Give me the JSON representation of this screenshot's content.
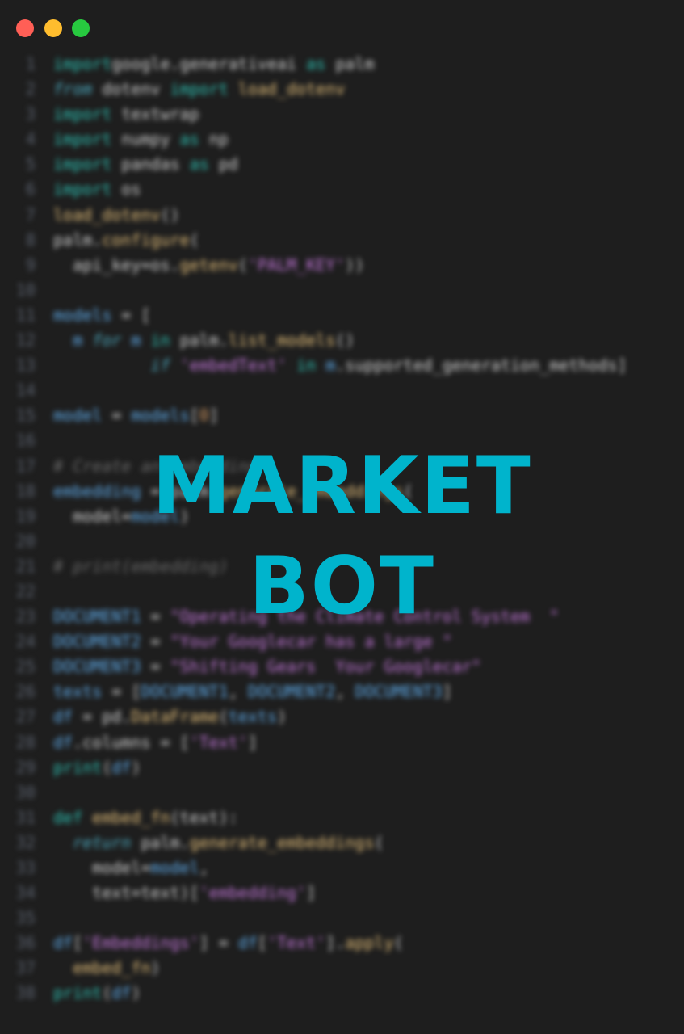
{
  "window": {
    "controls": [
      "close",
      "minimize",
      "zoom"
    ]
  },
  "code_lines": [
    {
      "n": "1",
      "parts": [
        [
          "kw",
          "import"
        ],
        [
          "",
          "google.generativeai "
        ],
        [
          "kw",
          "as"
        ],
        [
          "",
          " palm"
        ]
      ]
    },
    {
      "n": "2",
      "parts": [
        [
          "kw2",
          "from"
        ],
        [
          "",
          " dotenv "
        ],
        [
          "kw",
          "import"
        ],
        [
          "",
          " "
        ],
        [
          "fn",
          "load_dotenv"
        ]
      ]
    },
    {
      "n": "3",
      "parts": [
        [
          "kw",
          "import"
        ],
        [
          "",
          " textwrap"
        ]
      ]
    },
    {
      "n": "4",
      "parts": [
        [
          "kw",
          "import"
        ],
        [
          "",
          " numpy "
        ],
        [
          "kw",
          "as"
        ],
        [
          "",
          " np"
        ]
      ]
    },
    {
      "n": "5",
      "parts": [
        [
          "kw",
          "import"
        ],
        [
          "",
          " pandas "
        ],
        [
          "kw",
          "as"
        ],
        [
          "",
          " pd"
        ]
      ]
    },
    {
      "n": "6",
      "parts": [
        [
          "kw",
          "import"
        ],
        [
          "",
          " os"
        ]
      ]
    },
    {
      "n": "7",
      "parts": [
        [
          "fn",
          "load_dotenv"
        ],
        [
          "",
          "()"
        ]
      ]
    },
    {
      "n": "8",
      "parts": [
        [
          "",
          "palm."
        ],
        [
          "fn",
          "configure"
        ],
        [
          "",
          "("
        ]
      ]
    },
    {
      "n": "9",
      "parts": [
        [
          "",
          "  api_key=os."
        ],
        [
          "fn",
          "getenv"
        ],
        [
          "",
          "("
        ],
        [
          "str",
          "'PALM_KEY'"
        ],
        [
          "",
          "))"
        ]
      ]
    },
    {
      "n": "10",
      "parts": []
    },
    {
      "n": "11",
      "parts": [
        [
          "var",
          "models"
        ],
        [
          "",
          " = ["
        ]
      ]
    },
    {
      "n": "12",
      "parts": [
        [
          "",
          "  "
        ],
        [
          "var",
          "m"
        ],
        [
          "",
          " "
        ],
        [
          "kw2",
          "for"
        ],
        [
          "",
          " "
        ],
        [
          "var",
          "m"
        ],
        [
          "",
          " "
        ],
        [
          "kw",
          "in"
        ],
        [
          "",
          " palm."
        ],
        [
          "fn",
          "list_models"
        ],
        [
          "",
          "()"
        ]
      ]
    },
    {
      "n": "13",
      "parts": [
        [
          "",
          "          "
        ],
        [
          "kw2",
          "if"
        ],
        [
          "",
          " "
        ],
        [
          "str",
          "'embedText'"
        ],
        [
          "",
          " "
        ],
        [
          "kw",
          "in"
        ],
        [
          "",
          " "
        ],
        [
          "var",
          "m"
        ],
        [
          "",
          ".supported_generation_methods]"
        ]
      ]
    },
    {
      "n": "14",
      "parts": []
    },
    {
      "n": "15",
      "parts": [
        [
          "var",
          "model"
        ],
        [
          "",
          " = "
        ],
        [
          "var",
          "models"
        ],
        [
          "",
          "["
        ],
        [
          "num",
          "0"
        ],
        [
          "",
          "]"
        ]
      ]
    },
    {
      "n": "16",
      "parts": []
    },
    {
      "n": "17",
      "parts": [
        [
          "cm",
          "# Create an embedding"
        ]
      ]
    },
    {
      "n": "18",
      "parts": [
        [
          "var",
          "embedding"
        ],
        [
          "",
          " = palm."
        ],
        [
          "fn",
          "generate_embeddings"
        ],
        [
          "",
          "("
        ]
      ]
    },
    {
      "n": "19",
      "parts": [
        [
          "",
          "  model="
        ],
        [
          "var",
          "model"
        ],
        [
          "",
          ")"
        ]
      ]
    },
    {
      "n": "20",
      "parts": []
    },
    {
      "n": "21",
      "parts": [
        [
          "cm",
          "# print(embedding)"
        ]
      ]
    },
    {
      "n": "22",
      "parts": []
    },
    {
      "n": "23",
      "parts": [
        [
          "var",
          "DOCUMENT1"
        ],
        [
          "",
          " = "
        ],
        [
          "str",
          "\"Operating the Climate Control System  \""
        ]
      ]
    },
    {
      "n": "24",
      "parts": [
        [
          "var",
          "DOCUMENT2"
        ],
        [
          "",
          " = "
        ],
        [
          "str",
          "\"Your Googlecar has a large \""
        ]
      ]
    },
    {
      "n": "25",
      "parts": [
        [
          "var",
          "DOCUMENT3"
        ],
        [
          "",
          " = "
        ],
        [
          "str",
          "\"Shifting Gears  Your Googlecar\""
        ]
      ]
    },
    {
      "n": "26",
      "parts": [
        [
          "var",
          "texts"
        ],
        [
          "",
          " = ["
        ],
        [
          "var",
          "DOCUMENT1"
        ],
        [
          "",
          ", "
        ],
        [
          "var",
          "DOCUMENT2"
        ],
        [
          "",
          ", "
        ],
        [
          "var",
          "DOCUMENT3"
        ],
        [
          "",
          "]"
        ]
      ]
    },
    {
      "n": "27",
      "parts": [
        [
          "var",
          "df"
        ],
        [
          "",
          " = pd."
        ],
        [
          "fn",
          "DataFrame"
        ],
        [
          "",
          "("
        ],
        [
          "var",
          "texts"
        ],
        [
          "",
          ")"
        ]
      ]
    },
    {
      "n": "28",
      "parts": [
        [
          "var",
          "df"
        ],
        [
          "",
          ".columns = ["
        ],
        [
          "str",
          "'Text'"
        ],
        [
          "",
          "]"
        ]
      ]
    },
    {
      "n": "29",
      "parts": [
        [
          "kw",
          "print"
        ],
        [
          "",
          "("
        ],
        [
          "var",
          "df"
        ],
        [
          "",
          ")"
        ]
      ]
    },
    {
      "n": "30",
      "parts": []
    },
    {
      "n": "31",
      "parts": [
        [
          "kw",
          "def"
        ],
        [
          "",
          " "
        ],
        [
          "fn",
          "embed_fn"
        ],
        [
          "",
          "(text):"
        ]
      ]
    },
    {
      "n": "32",
      "parts": [
        [
          "",
          "  "
        ],
        [
          "kw2",
          "return"
        ],
        [
          "",
          " palm."
        ],
        [
          "fn",
          "generate_embeddings"
        ],
        [
          "",
          "("
        ]
      ]
    },
    {
      "n": "33",
      "parts": [
        [
          "",
          "    model="
        ],
        [
          "var",
          "model"
        ],
        [
          "",
          ","
        ]
      ]
    },
    {
      "n": "34",
      "parts": [
        [
          "",
          "    text=text)["
        ],
        [
          "str",
          "'embedding'"
        ],
        [
          "",
          "]"
        ]
      ]
    },
    {
      "n": "35",
      "parts": []
    },
    {
      "n": "36",
      "parts": [
        [
          "var",
          "df"
        ],
        [
          "",
          "["
        ],
        [
          "str",
          "'Embeddings'"
        ],
        [
          "",
          "] = "
        ],
        [
          "var",
          "df"
        ],
        [
          "",
          "["
        ],
        [
          "str",
          "'Text'"
        ],
        [
          "",
          "]."
        ],
        [
          "fn",
          "apply"
        ],
        [
          "",
          "("
        ]
      ]
    },
    {
      "n": "37",
      "parts": [
        [
          "",
          "  "
        ],
        [
          "fn",
          "embed_fn"
        ],
        [
          "",
          ")"
        ]
      ]
    },
    {
      "n": "38",
      "parts": [
        [
          "kw",
          "print"
        ],
        [
          "",
          "("
        ],
        [
          "var",
          "df"
        ],
        [
          "",
          ")"
        ]
      ]
    }
  ],
  "overlay": {
    "line1": "MARKET",
    "line2": "BOT"
  },
  "colors": {
    "background": "#1e1e1e",
    "overlay_text": "#00b4cc",
    "close": "#ff5f56",
    "minimize": "#ffbd2e",
    "zoom": "#27c93f"
  }
}
